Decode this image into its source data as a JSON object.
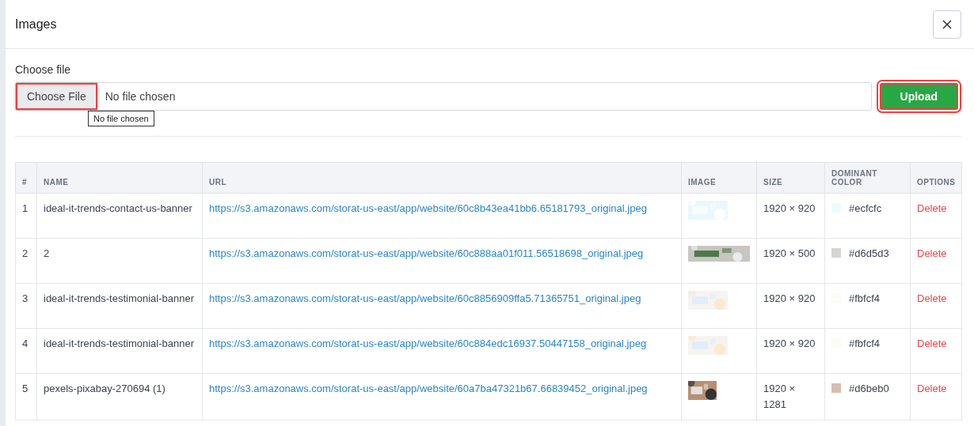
{
  "window": {
    "title": "Images"
  },
  "upload": {
    "label": "Choose file",
    "choose_button": {
      "label": "Choose File",
      "highlighted": true
    },
    "file_status": "No file chosen",
    "tooltip": "No file chosen",
    "upload_button": {
      "label": "Upload",
      "highlighted": true
    }
  },
  "table": {
    "columns": [
      "#",
      "NAME",
      "URL",
      "IMAGE",
      "SIZE",
      "DOMINANT COLOR",
      "OPTIONS"
    ],
    "rows": [
      {
        "index": "1",
        "name": "ideal-it-trends-contact-us-banner",
        "url": "https://s3.amazonaws.com/storat-us-east/app/website/60c8b43ea41bb6.65181793_original.jpeg",
        "size": "1920 × 920",
        "color": "#ecfcfc",
        "color_label": "#ecfcfc",
        "option": "Delete"
      },
      {
        "index": "2",
        "name": "2",
        "url": "https://s3.amazonaws.com/storat-us-east/app/website/60c888aa01f011.56518698_original.jpeg",
        "size": "1920 × 500",
        "color": "#d6d5d3",
        "color_label": "#d6d5d3",
        "option": "Delete"
      },
      {
        "index": "3",
        "name": "ideal-it-trends-testimonial-banner",
        "url": "https://s3.amazonaws.com/storat-us-east/app/website/60c8856909ffa5.71365751_original.jpeg",
        "size": "1920 × 920",
        "color": "#fbfcf4",
        "color_label": "#fbfcf4",
        "option": "Delete"
      },
      {
        "index": "4",
        "name": "ideal-it-trends-testimonial-banner",
        "url": "https://s3.amazonaws.com/storat-us-east/app/website/60c884edc16937.50447158_original.jpeg",
        "size": "1920 × 920",
        "color": "#fbfcf4",
        "color_label": "#fbfcf4",
        "option": "Delete"
      },
      {
        "index": "5",
        "name": "pexels-pixabay-270694 (1)",
        "url": "https://s3.amazonaws.com/storat-us-east/app/website/60a7ba47321b67.66839452_original.jpeg",
        "size": "1920 × 1281",
        "color": "#d6beb0",
        "color_label": "#d6beb0",
        "option": "Delete"
      }
    ]
  }
}
